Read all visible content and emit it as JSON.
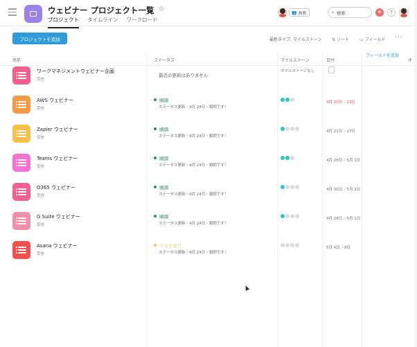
{
  "header": {
    "title": "ウェビナー プロジェクト一覧",
    "tabs": [
      {
        "label": "プロジェクト",
        "active": true
      },
      {
        "label": "タイムライン",
        "active": false
      },
      {
        "label": "ワークロード",
        "active": false
      }
    ],
    "share_label": "共有",
    "search_placeholder": "検索",
    "help_label": "?",
    "plus_label": "+"
  },
  "toolbar": {
    "add_project_label": "プロジェクトを追加",
    "filter_type_label": "最新タイプ, マイルストーン",
    "sort_label": "ソート",
    "field_label": "フィールド",
    "more_label": "···"
  },
  "columns": {
    "name": "名前",
    "status": "ステータス",
    "milestone": "マイルストーン",
    "date": "日付",
    "add_field": "フィールドを追加",
    "owner": "オ"
  },
  "colors": {
    "accent": "#2d9cdb",
    "on_track": "#2d8a5a",
    "at_risk": "#f1bd6c",
    "overdue": "#e0504f",
    "milestone_done": "#2ec4c6",
    "milestone_empty": "#d8dcde"
  },
  "rows": [
    {
      "name": "ワークマネジメントウェビナー企画",
      "sub": "受信",
      "icon_color": "#f0608c",
      "status": null,
      "status_text": "最近の更新はありません",
      "status_update": "",
      "milestone_text": "マイルストーンなし",
      "milestones": [],
      "date": "",
      "date_overdue": false,
      "date_icon": "calendar-icon"
    },
    {
      "name": "AWS ウェビナー",
      "sub": "受信",
      "icon_color": "#f59b47",
      "status": "順調",
      "status_color": "#2d8a5a",
      "status_update": "ステータス更新・4月 24日・順調です！",
      "milestone_text": "",
      "milestones": [
        1,
        1,
        0
      ],
      "date": "4月 20日 – 23日",
      "date_overdue": true
    },
    {
      "name": "Zapier ウェビナー",
      "sub": "受信",
      "icon_color": "#f7c04a",
      "status": "順調",
      "status_color": "#2d8a5a",
      "status_update": "ステータス更新・4月 24日・順調です！",
      "milestone_text": "",
      "milestones": [
        1,
        0,
        0,
        0
      ],
      "date": "4月 21日 – 27日",
      "date_overdue": false
    },
    {
      "name": "Teams ウェビナー",
      "sub": "受信",
      "icon_color": "#f472d0",
      "status": "順調",
      "status_color": "#2d8a5a",
      "status_update": "ステータス更新・4月 24日・順調です！",
      "milestone_text": "",
      "milestones": [
        1,
        1,
        0
      ],
      "date": "4月 28日 – 5月 1日",
      "date_overdue": false
    },
    {
      "name": "O365 ウェビナー",
      "sub": "受信",
      "icon_color": "#f06292",
      "status": "順調",
      "status_color": "#2d8a5a",
      "status_update": "ステータス更新・4月 24日・順調です！",
      "milestone_text": "",
      "milestones": [
        1,
        0,
        0,
        0
      ],
      "date": "4月 30日 – 5月 2日",
      "date_overdue": false
    },
    {
      "name": "G Suite ウェビナー",
      "sub": "受信",
      "icon_color": "#f48fa8",
      "status": "順調",
      "status_color": "#2d8a5a",
      "status_update": "ステータス更新・4月 24日・順調です！",
      "milestone_text": "",
      "milestones": [
        1,
        0,
        0,
        0
      ],
      "date": "4月 28日 – 5月 1日",
      "date_overdue": false
    },
    {
      "name": "Asana ウェビナー",
      "sub": "受信",
      "icon_color": "#f0504f",
      "status": "リスクあり",
      "status_color": "#f1bd6c",
      "status_update": "ステータス更新・4月 24日・順調です！",
      "milestone_text": "",
      "milestones": [
        0,
        0,
        0,
        0
      ],
      "date": "5月 4日 – 8日",
      "date_overdue": false
    }
  ]
}
